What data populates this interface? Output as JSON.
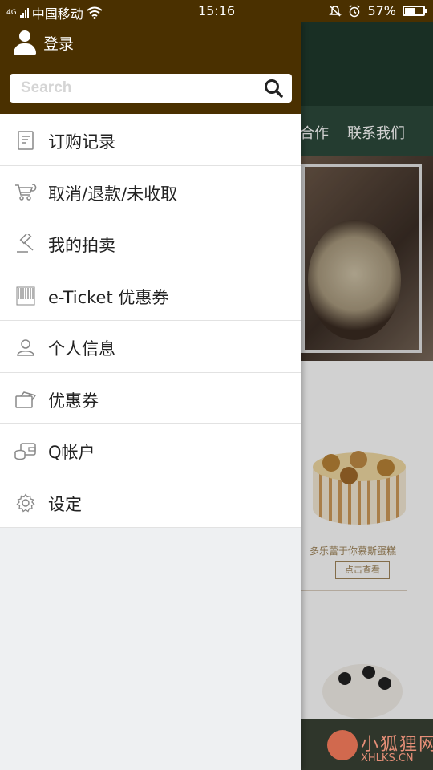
{
  "status_bar": {
    "carrier_tag": "4G",
    "carrier": "中国移动",
    "time": "15:16",
    "battery_percent": "57%",
    "battery_level": 0.57,
    "icons": [
      "signal-icon",
      "wifi-icon",
      "mute-icon",
      "alarm-icon",
      "battery-icon"
    ]
  },
  "drawer": {
    "header": {
      "login_label": "登录",
      "search_placeholder": "Search",
      "background_color": "#4a3000"
    },
    "menu": [
      {
        "label": "订购记录",
        "icon": "receipt-icon"
      },
      {
        "label": "取消/退款/未收取",
        "icon": "cart-refund-icon"
      },
      {
        "label": "我的拍卖",
        "icon": "gavel-icon"
      },
      {
        "label": "e-Ticket 优惠券",
        "icon": "barcode-ticket-icon"
      },
      {
        "label": "个人信息",
        "icon": "person-icon"
      },
      {
        "label": "优惠券",
        "icon": "coupon-icon"
      },
      {
        "label": "Q帐户",
        "icon": "wallet-icon"
      },
      {
        "label": "设定",
        "icon": "gear-icon"
      }
    ]
  },
  "background_page": {
    "nav": [
      "合作",
      "联系我们"
    ],
    "product": {
      "title": "多乐蕾于你慕斯蛋糕",
      "button": "点击查看"
    }
  },
  "watermark": {
    "text_cn": "小狐狸网",
    "text_en": "XHLKS.CN"
  }
}
